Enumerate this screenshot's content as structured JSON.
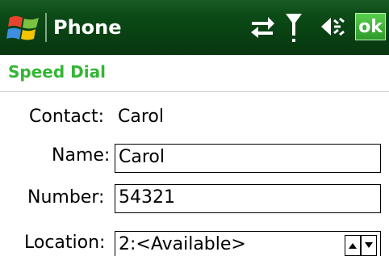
{
  "titlebar": {
    "app_title": "Phone",
    "ok_label": "ok",
    "icons": [
      "windows-start-icon",
      "sync-icon",
      "signal-icon",
      "volume-icon"
    ]
  },
  "page": {
    "title": "Speed Dial"
  },
  "form": {
    "contact_label": "Contact:",
    "contact_value": "Carol",
    "name_label": "Name:",
    "name_value": "Carol",
    "number_label": "Number:",
    "number_value": "54321",
    "location_label": "Location:",
    "location_value": "2:<Available>"
  },
  "colors": {
    "titlebar_bg": "#0b4a16",
    "ok_bg": "#38a838",
    "page_title": "#33b633"
  }
}
